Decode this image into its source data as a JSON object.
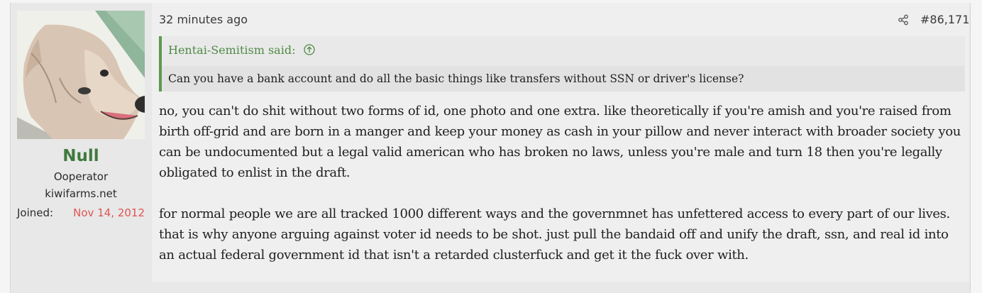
{
  "user": {
    "name": "Null",
    "title": "Ooperator",
    "banner": "kiwifarms.net",
    "joined_label": "Joined:",
    "joined_date": "Nov 14, 2012"
  },
  "post": {
    "timestamp": "32 minutes ago",
    "number": "#86,171",
    "quote": {
      "author": "Hentai-Semitism said:",
      "text": "Can you have a bank account and do all the basic things like transfers without SSN or driver's license?"
    },
    "paragraphs": [
      "no, you can't do shit without two forms of id, one photo and one extra. like theoretically if you're amish and you're raised from birth off-grid and are born in a manger and keep your money as cash in your pillow and never interact with broader society you can be undocumented but a legal valid american who has broken no laws, unless you're male and turn 18 then you're legally obligated to enlist in the draft.",
      "for normal people we are all tracked 1000 different ways and the governmnet has unfettered access to every part of our lives. that is why anyone arguing against voter id needs to be shot. just pull the bandaid off and unify the draft, ssn, and real id into an actual federal government id that isn't a retarded clusterfuck and get it the fuck over with."
    ]
  },
  "icons": {
    "share": "share-icon",
    "quote_jump": "arrow-up-circle-icon",
    "avatar": "dog-avatar"
  },
  "colors": {
    "username": "#3f7a3e",
    "joined_date": "#e05454",
    "quote_accent": "#5b9a4c"
  }
}
